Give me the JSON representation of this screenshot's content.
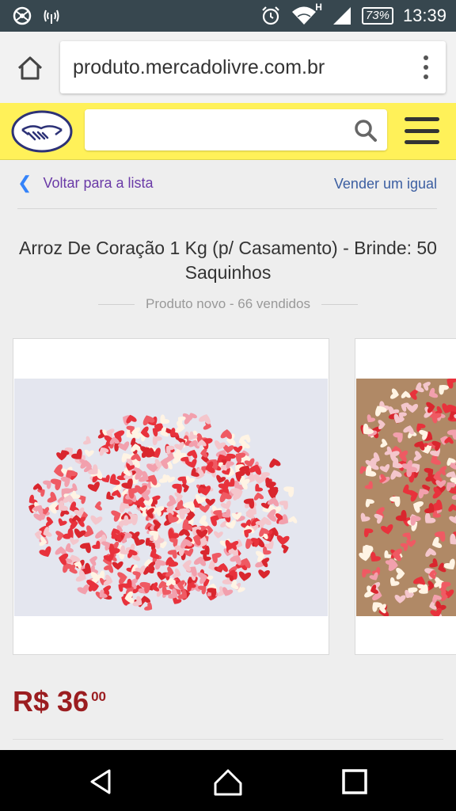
{
  "status_bar": {
    "time": "13:39",
    "battery": "73%",
    "network_badge": "H",
    "icons": [
      "settings-icon",
      "signal-broadcast-icon",
      "alarm-icon",
      "wifi-icon",
      "cell-signal-icon",
      "battery-icon"
    ]
  },
  "browser": {
    "url": "produto.mercadolivre.com.br",
    "icons": [
      "home-icon",
      "more-vert-icon"
    ]
  },
  "ml_header": {
    "search_placeholder": "",
    "icons": [
      "mercadolivre-logo",
      "search-icon",
      "menu-icon"
    ],
    "brand_color": "#fff159"
  },
  "product": {
    "back_label": "Voltar para a lista",
    "sell_label": "Vender um igual",
    "title": "Arroz De Coração 1 Kg (p/ Casamento) - Brinde: 50 Saquinhos",
    "subtitle": "Produto novo - 66 vendidos",
    "price_main": "R$ 36",
    "price_cents": "00",
    "price_color": "#9b1d20"
  },
  "nav_bar": {
    "icons": [
      "back-icon",
      "home-icon",
      "recents-icon"
    ]
  }
}
